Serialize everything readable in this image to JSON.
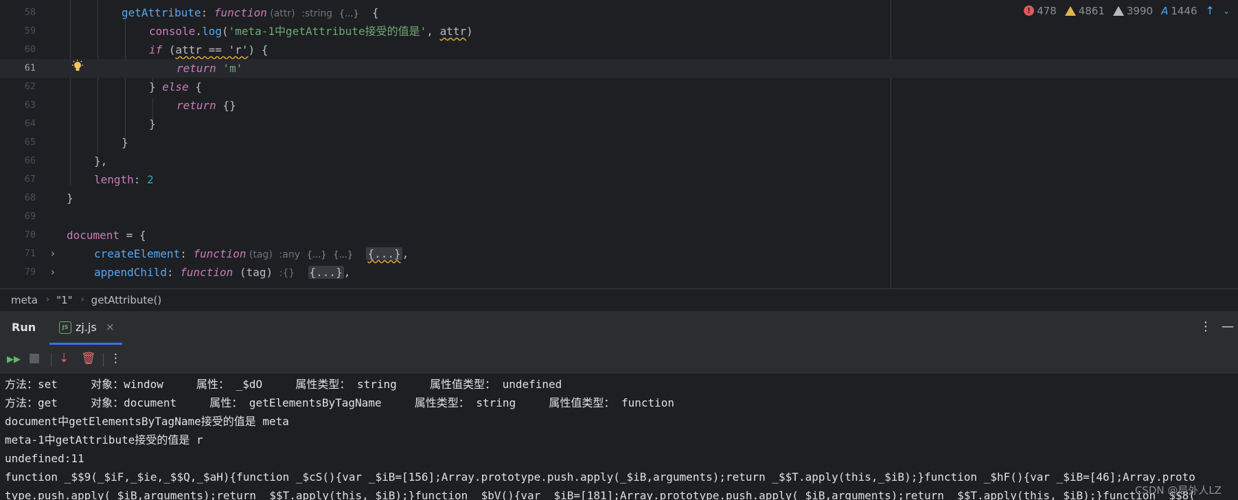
{
  "editor": {
    "line_numbers": [
      "58",
      "59",
      "60",
      "61",
      "62",
      "63",
      "64",
      "65",
      "66",
      "67",
      "68",
      "69",
      "70",
      "71",
      "79"
    ],
    "inspections": {
      "errors": "478",
      "warnings": "4861",
      "weak_warnings": "3990",
      "typos": "1446"
    },
    "code": {
      "l58_prop": "getAttribute",
      "l58_colon": ": ",
      "l58_kw": "function",
      "l58_paren": " (attr)",
      "l58_hint": ":string",
      "l58_hint2": "{...}",
      "l58_brace": "  {",
      "l59_obj": "console",
      "l59_dot": ".",
      "l59_fn": "log",
      "l59_open": "(",
      "l59_str": "'meta-1中getAttribute接受的值是'",
      "l59_comma": ", ",
      "l59_arg": "attr",
      "l59_close": ")",
      "l60_kw": "if",
      "l60_open": " (",
      "l60_cond": "attr == 'r'",
      "l60_close": ") {",
      "l61_kw": "return",
      "l61_str": " 'm'",
      "l62_close": "} ",
      "l62_kw": "else",
      "l62_open": " {",
      "l63_kw": "return",
      "l63_val": " {}",
      "l64_close": "}",
      "l65_close": "}",
      "l66_close": "},",
      "l67_prop": "length",
      "l67_colon": ": ",
      "l67_num": "2",
      "l68_close": "}",
      "l70_glob": "document",
      "l70_rest": " = {",
      "l71_prop": "createElement",
      "l71_colon": ": ",
      "l71_kw": "function",
      "l71_paren": " (tag)",
      "l71_hint": ":any",
      "l71_hint2": "{...}",
      "l71_hint3": "{...}",
      "l71_collapsed": "{...}",
      "l71_comma": ",",
      "l79_prop": "appendChild",
      "l79_colon": ": ",
      "l79_kw": "function",
      "l79_paren": " (tag)",
      "l79_hint": ":{}",
      "l79_collapsed": "{...}",
      "l79_comma": ","
    }
  },
  "breadcrumb": {
    "items": [
      "meta",
      "\"1\"",
      "getAttribute()"
    ]
  },
  "run_panel": {
    "title": "Run",
    "tab_label": "zj.js",
    "tab_icon": "JS"
  },
  "console": {
    "lines": [
      "方法：set     对象：window     属性： _$dO     属性类型： string     属性值类型： undefined",
      "方法：get     对象：document     属性： getElementsByTagName     属性类型： string     属性值类型： function",
      "document中getElementsByTagName接受的值是 meta",
      "meta-1中getAttribute接受的值是 r",
      "undefined:11",
      "function _$$9(_$iF,_$ie,_$$Q,_$aH){function _$cS(){var _$iB=[156];Array.prototype.push.apply(_$iB,arguments);return _$$T.apply(this,_$iB);}function _$hF(){var _$iB=[46];Array.proto",
      "type.push.apply(_$iB,arguments);return _$$T.apply(this,_$iB);}function _$bV(){var _$iB=[181];Array.prototype.push.apply(_$iB,arguments);return _$$T.apply(this,_$iB);}function _$$8("
    ]
  },
  "watermark": "CSDN @局外人LZ",
  "colors": {
    "background": "#1e1f22",
    "panel": "#2b2d30",
    "accent": "#3574f0",
    "keyword": "#cf8e6d",
    "string": "#6aab73",
    "property": "#56a8f5",
    "number": "#2aacb8",
    "error": "#db5c5c"
  }
}
